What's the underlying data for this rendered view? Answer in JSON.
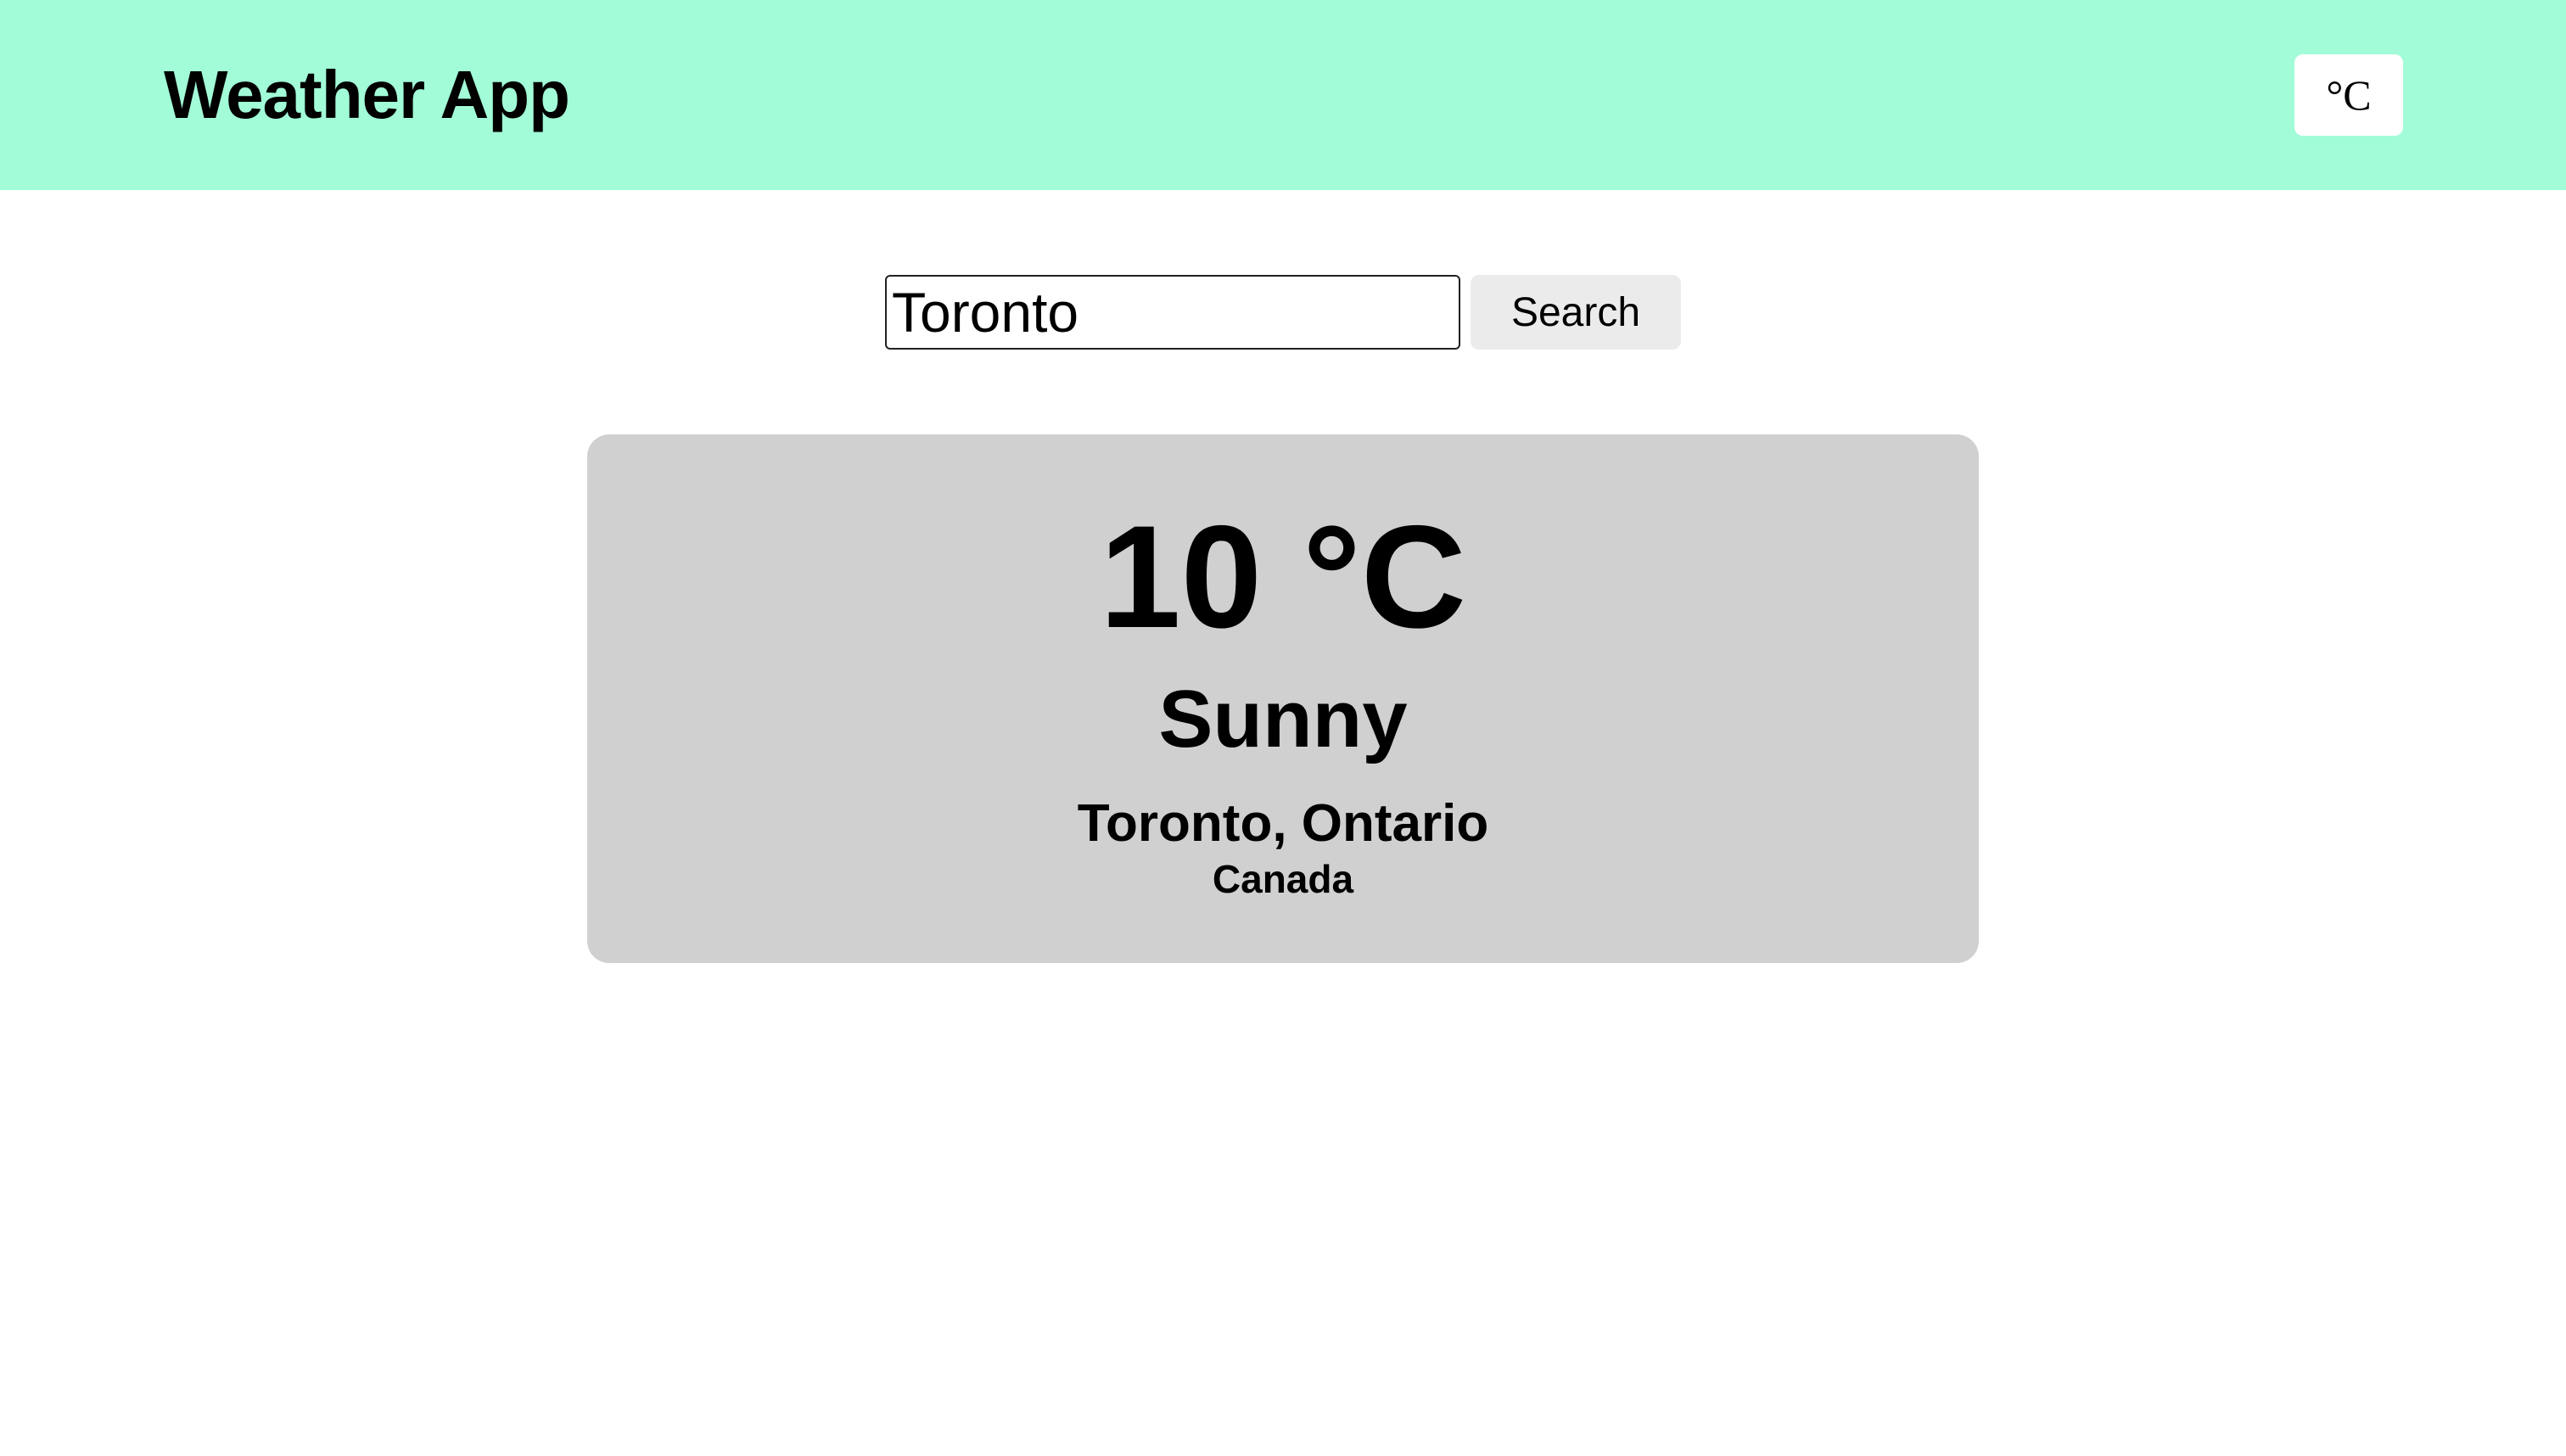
{
  "header": {
    "title": "Weather App",
    "unit_toggle_label": "°C",
    "background_color": "#a2fcd7"
  },
  "search": {
    "value": "Toronto",
    "placeholder": "",
    "button_label": "Search"
  },
  "weather": {
    "temperature": "10 °C",
    "condition": "Sunny",
    "location": "Toronto, Ontario",
    "country": "Canada",
    "card_color": "#d0d0d0"
  }
}
